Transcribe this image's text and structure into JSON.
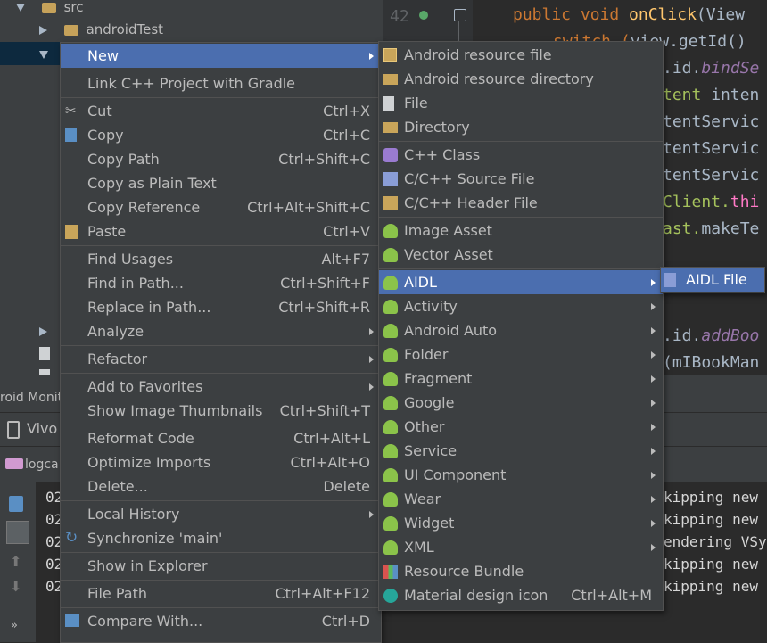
{
  "project_tree": {
    "items": [
      {
        "label": "src"
      },
      {
        "label": "androidTest"
      }
    ]
  },
  "editor": {
    "line_number": "42",
    "lines": [
      {
        "p1": "public ",
        "p2": "void ",
        "p3": "onClick",
        "p4": "(View"
      },
      {
        "p1": "switch (",
        "p2": "view",
        "p3": ".getId()",
        "p4": ""
      },
      {
        "p1": ".id.",
        "p2": "bindSe",
        "p3": "",
        "p4": ""
      },
      {
        "p1": "tent ",
        "p2": "inten",
        "p3": "",
        "p4": ""
      },
      {
        "p1": "tentServic",
        "p2": "",
        "p3": "",
        "p4": ""
      },
      {
        "p1": "tentServic",
        "p2": "",
        "p3": "",
        "p4": ""
      },
      {
        "p1": "tentServic",
        "p2": "",
        "p3": "",
        "p4": ""
      },
      {
        "p1": "Client.",
        "p2": "thi",
        "p3": "",
        "p4": ""
      },
      {
        "p1": "ast.",
        "p2": "makeTe",
        "p3": "",
        "p4": ""
      },
      {
        "p1": ".id.",
        "p2": "addBoo",
        "p3": "",
        "p4": ""
      },
      {
        "p1": "(mIBookMan",
        "p2": "",
        "p3": "",
        "p4": ""
      }
    ]
  },
  "bottom_panel": {
    "monitor_tab": "roid Monit",
    "device": "Vivo",
    "logcat_tab": "logca",
    "log_prefix": [
      "02",
      "02",
      "02",
      "02",
      "02"
    ],
    "log_tail": [
      "kipping new",
      "kipping new",
      "endering VSy",
      "kipping new",
      "kipping new"
    ]
  },
  "context_menu": {
    "items": [
      {
        "label": "New",
        "shortcut": "",
        "submenu": true,
        "selected": true
      },
      {
        "label": "Link C++ Project with Gradle",
        "shortcut": ""
      },
      {
        "label": "Cut",
        "shortcut": "Ctrl+X",
        "icon": "scissors-icon"
      },
      {
        "label": "Copy",
        "shortcut": "Ctrl+C",
        "icon": "copy-icon"
      },
      {
        "label": "Copy Path",
        "shortcut": "Ctrl+Shift+C"
      },
      {
        "label": "Copy as Plain Text",
        "shortcut": ""
      },
      {
        "label": "Copy Reference",
        "shortcut": "Ctrl+Alt+Shift+C"
      },
      {
        "label": "Paste",
        "shortcut": "Ctrl+V",
        "icon": "paste-icon"
      },
      {
        "label": "Find Usages",
        "shortcut": "Alt+F7"
      },
      {
        "label": "Find in Path...",
        "shortcut": "Ctrl+Shift+F"
      },
      {
        "label": "Replace in Path...",
        "shortcut": "Ctrl+Shift+R"
      },
      {
        "label": "Analyze",
        "shortcut": "",
        "submenu": true
      },
      {
        "label": "Refactor",
        "shortcut": "",
        "submenu": true
      },
      {
        "label": "Add to Favorites",
        "shortcut": "",
        "submenu": true
      },
      {
        "label": "Show Image Thumbnails",
        "shortcut": "Ctrl+Shift+T"
      },
      {
        "label": "Reformat Code",
        "shortcut": "Ctrl+Alt+L"
      },
      {
        "label": "Optimize Imports",
        "shortcut": "Ctrl+Alt+O"
      },
      {
        "label": "Delete...",
        "shortcut": "Delete"
      },
      {
        "label": "Local History",
        "shortcut": "",
        "submenu": true
      },
      {
        "label": "Synchronize 'main'",
        "shortcut": "",
        "icon": "sync-icon"
      },
      {
        "label": "Show in Explorer",
        "shortcut": ""
      },
      {
        "label": "File Path",
        "shortcut": "Ctrl+Alt+F12"
      },
      {
        "label": "Compare With...",
        "shortcut": "Ctrl+D",
        "icon": "compare-icon"
      }
    ]
  },
  "new_submenu": {
    "items": [
      {
        "label": "Android resource file",
        "icon": "android-resource-file-icon"
      },
      {
        "label": "Android resource directory",
        "icon": "folder-icon"
      },
      {
        "label": "File",
        "icon": "file-icon"
      },
      {
        "label": "Directory",
        "icon": "folder-icon"
      },
      {
        "label": "C++ Class",
        "icon": "cpp-class-icon"
      },
      {
        "label": "C/C++ Source File",
        "icon": "cpp-source-icon"
      },
      {
        "label": "C/C++ Header File",
        "icon": "cpp-header-icon"
      },
      {
        "label": "Image Asset",
        "icon": "android-icon"
      },
      {
        "label": "Vector Asset",
        "icon": "android-icon"
      },
      {
        "label": "AIDL",
        "icon": "android-icon",
        "submenu": true,
        "selected": true
      },
      {
        "label": "Activity",
        "icon": "android-icon",
        "submenu": true
      },
      {
        "label": "Android Auto",
        "icon": "android-icon",
        "submenu": true
      },
      {
        "label": "Folder",
        "icon": "android-icon",
        "submenu": true
      },
      {
        "label": "Fragment",
        "icon": "android-icon",
        "submenu": true
      },
      {
        "label": "Google",
        "icon": "android-icon",
        "submenu": true
      },
      {
        "label": "Other",
        "icon": "android-icon",
        "submenu": true
      },
      {
        "label": "Service",
        "icon": "android-icon",
        "submenu": true
      },
      {
        "label": "UI Component",
        "icon": "android-icon",
        "submenu": true
      },
      {
        "label": "Wear",
        "icon": "android-icon",
        "submenu": true
      },
      {
        "label": "Widget",
        "icon": "android-icon",
        "submenu": true
      },
      {
        "label": "XML",
        "icon": "android-icon",
        "submenu": true
      },
      {
        "label": "Resource Bundle",
        "icon": "resource-bundle-icon"
      },
      {
        "label": "Material design icon",
        "icon": "material-icon",
        "shortcut": "Ctrl+Alt+M"
      }
    ]
  },
  "aidl_submenu": {
    "items": [
      {
        "label": "AIDL File",
        "icon": "aidl-file-icon",
        "selected": true
      }
    ]
  }
}
